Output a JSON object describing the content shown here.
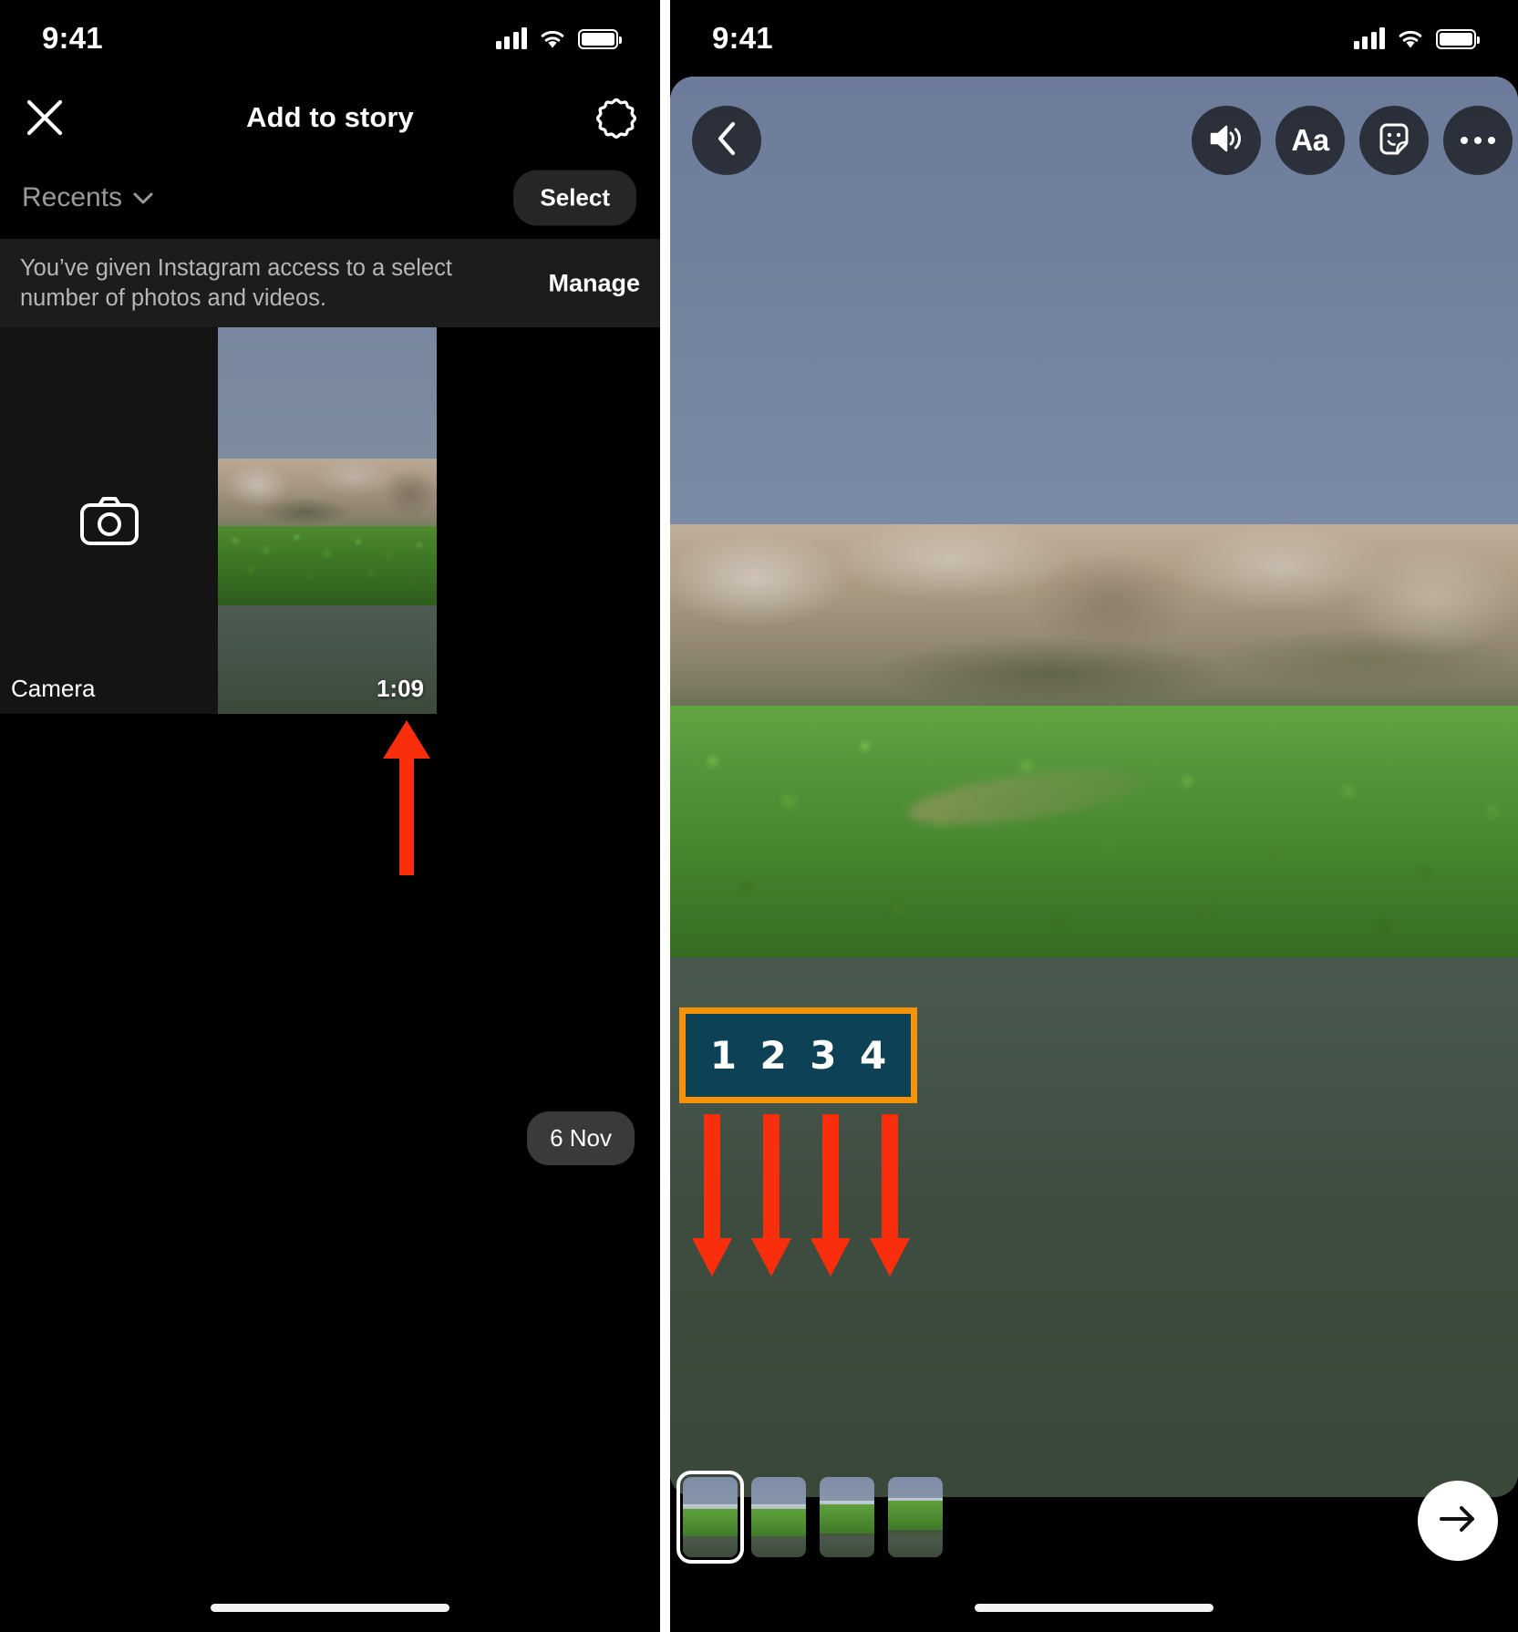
{
  "left_phone": {
    "status_bar": {
      "time": "9:41",
      "signal_icon": "cellular-signal-icon",
      "wifi_icon": "wifi-icon",
      "battery_icon": "battery-icon"
    },
    "nav": {
      "close_icon": "close-x-icon",
      "title": "Add to story",
      "settings_icon": "gear-icon"
    },
    "album_bar": {
      "album_label": "Recents",
      "chevron_icon": "chevron-down-icon",
      "select_label": "Select"
    },
    "permission_banner": {
      "message": "You’ve given Instagram access to a select number of photos and videos.",
      "action_label": "Manage"
    },
    "gallery": {
      "camera_tile": {
        "icon": "camera-icon",
        "label": "Camera"
      },
      "video_tile": {
        "duration": "1:09"
      },
      "date_pill": "6 Nov"
    }
  },
  "right_phone": {
    "status_bar": {
      "time": "9:41",
      "signal_icon": "cellular-signal-icon",
      "wifi_icon": "wifi-icon",
      "battery_icon": "battery-icon"
    },
    "editor_controls": {
      "back_icon": "chevron-left-icon",
      "volume_icon": "speaker-volume-icon",
      "text_label": "Aa",
      "sticker_icon": "sticker-smiley-icon",
      "more_icon": "more-horizontal-icon"
    },
    "filmstrip": {
      "frames": [
        {
          "index": "1",
          "selected": true
        },
        {
          "index": "2",
          "selected": false
        },
        {
          "index": "3",
          "selected": false
        },
        {
          "index": "4",
          "selected": false
        }
      ]
    },
    "next_button": {
      "icon": "arrow-right-icon"
    }
  },
  "annotations": {
    "arrow_color": "#f82e0c",
    "box_border_color": "#f79208",
    "box_fill_color": "#0d4156",
    "numbers": [
      "1",
      "2",
      "3",
      "4"
    ],
    "up_arrow": "callout-arrow-up",
    "down_arrows": [
      "callout-arrow-down-1",
      "callout-arrow-down-2",
      "callout-arrow-down-3",
      "callout-arrow-down-4"
    ]
  }
}
